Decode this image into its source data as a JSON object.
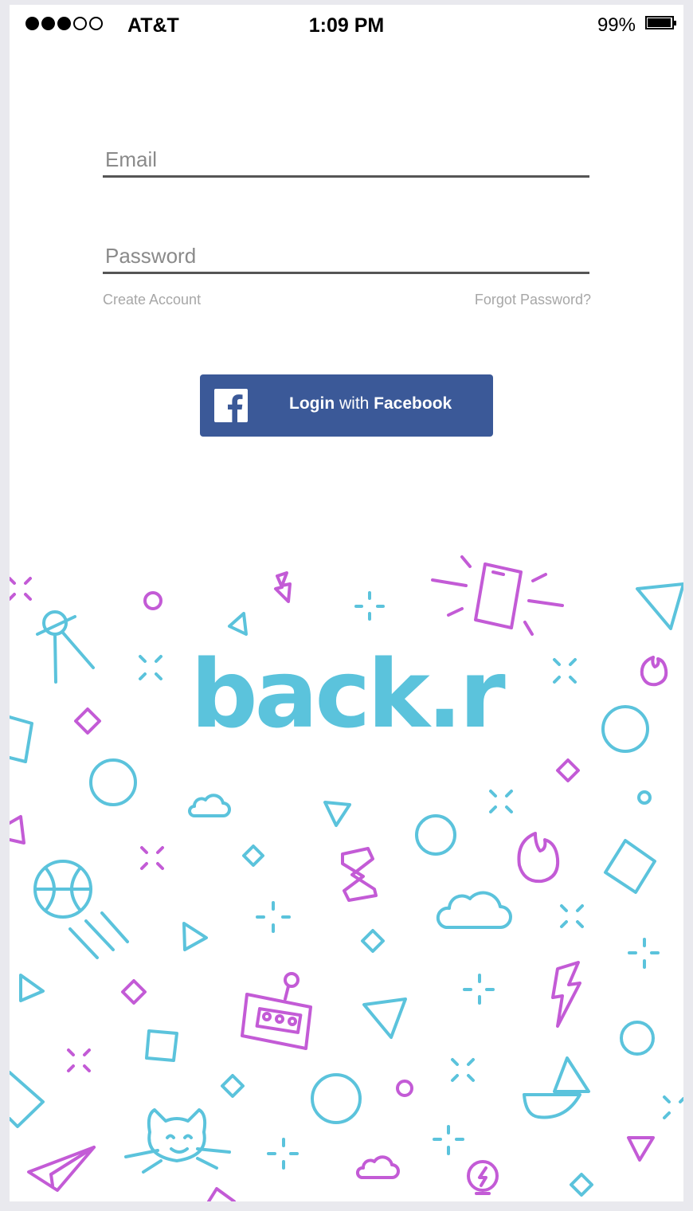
{
  "status_bar": {
    "signal_full": 3,
    "signal_total": 5,
    "carrier": "AT&T",
    "time": "1:09 PM",
    "battery_percent": "99%",
    "battery_level": 0.99
  },
  "login": {
    "email_placeholder": "Email",
    "email_value": "",
    "password_placeholder": "Password",
    "password_value": "",
    "create_account_label": "Create Account",
    "forgot_password_label": "Forgot Password?"
  },
  "facebook_button": {
    "label_part1": "Login",
    "label_part2": " with ",
    "label_part3": "Facebook",
    "icon": "facebook-icon",
    "color": "#3b5998"
  },
  "brand": {
    "logo_text": "back.r",
    "logo_color": "#5bc3dc",
    "accent_color": "#c35bd6"
  }
}
